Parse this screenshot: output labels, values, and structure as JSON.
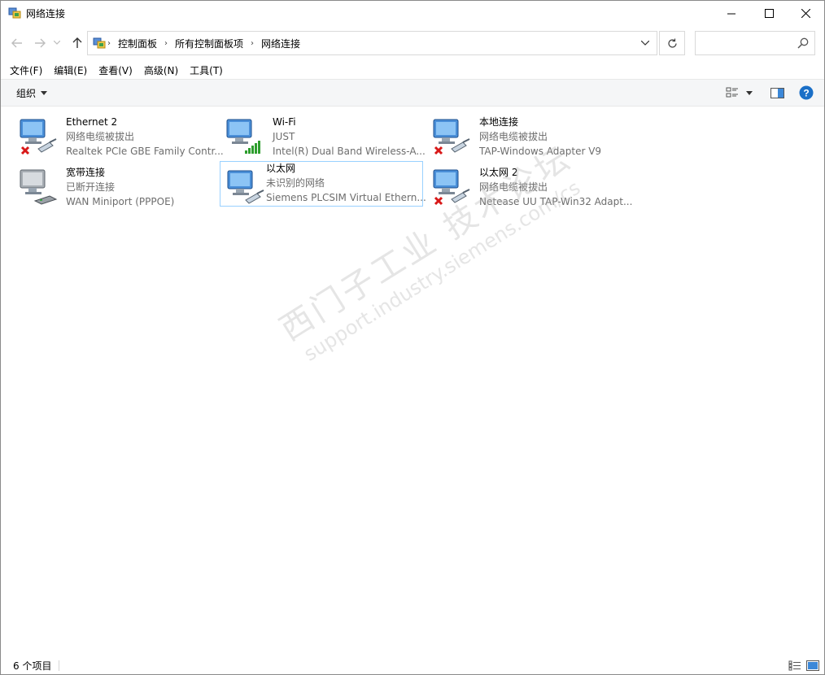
{
  "window": {
    "title": "网络连接"
  },
  "nav": {
    "back_icon": "arrow-left-icon",
    "forward_icon": "arrow-right-icon",
    "up_icon": "arrow-up-icon",
    "breadcrumbs": [
      "控制面板",
      "所有控制面板项",
      "网络连接"
    ],
    "search_placeholder": ""
  },
  "menu": [
    "文件(F)",
    "编辑(E)",
    "查看(V)",
    "高级(N)",
    "工具(T)"
  ],
  "commandbar": {
    "organize_label": "组织"
  },
  "connections": [
    {
      "name": "Ethernet 2",
      "status": "网络电缆被拔出",
      "device": "Realtek PCIe GBE Family Contr...",
      "kind": "ethernet-disconnected"
    },
    {
      "name": "Wi-Fi",
      "status": "JUST",
      "device": "Intel(R) Dual Band Wireless-A...",
      "kind": "wifi"
    },
    {
      "name": "本地连接",
      "status": "网络电缆被拔出",
      "device": "TAP-Windows Adapter V9",
      "kind": "ethernet-disconnected"
    },
    {
      "name": "宽带连接",
      "status": "已断开连接",
      "device": "WAN Miniport (PPPOE)",
      "kind": "broadband"
    },
    {
      "name": "以太网",
      "status": "未识别的网络",
      "device": "Siemens PLCSIM Virtual Ethern...",
      "kind": "ethernet"
    },
    {
      "name": "以太网 2",
      "status": "网络电缆被拔出",
      "device": "Netease UU TAP-Win32 Adapt...",
      "kind": "ethernet-disconnected"
    }
  ],
  "watermark": {
    "line1": "西门子工业 技术论坛",
    "line2": "support.industry.siemens.com/cs"
  },
  "statusbar": {
    "count": "6 个项目"
  },
  "colors": {
    "accent": "#0078d7",
    "selected_border": "#99d1ff",
    "error_red": "#e81123",
    "signal_green": "#2e9e2e"
  }
}
